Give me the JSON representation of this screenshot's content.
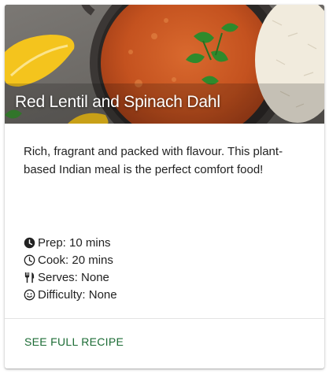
{
  "card": {
    "title": "Red Lentil and Spinach Dahl",
    "image_icon": "dahl-dish-photo",
    "description": "Rich, fragrant and packed with flavour. This plant-based Indian meal is the perfect comfort food!",
    "details": [
      {
        "icon": "clock-filled-icon",
        "label": "Prep: 10 mins"
      },
      {
        "icon": "clock-outline-icon",
        "label": "Cook: 20 mins"
      },
      {
        "icon": "utensils-icon",
        "label": "Serves: None"
      },
      {
        "icon": "smile-icon",
        "label": "Difficulty: None"
      }
    ],
    "action_label": "SEE FULL RECIPE"
  },
  "colors": {
    "link": "#1b6b34",
    "text": "#222222",
    "divider": "#e3e3e3",
    "title_text": "#ffffff"
  }
}
